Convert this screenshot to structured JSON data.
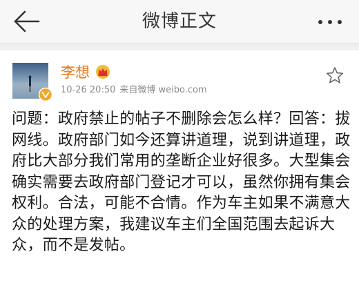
{
  "header": {
    "title": "微博正文",
    "back_icon": "back-arrow-icon",
    "more_icon": "more-dots-icon"
  },
  "post": {
    "author": "李想",
    "author_badge_icon": "crown-icon",
    "verified_icon": "verified-v-icon",
    "time": "10-26 20:50",
    "source": "来自微博 weibo.com",
    "favorite_icon": "star-outline-icon",
    "text": "问题：政府禁止的帖子不删除会怎么样？回答：拔网线。政府部门如今还算讲道理，说到讲道理，政府比大部分我们常用的垄断企业好很多。大型集会确实需要去政府部门登记才可以，虽然你拥有集会权利。合法，可能不合情。作为车主如果不满意大众的处理方案，我建议车主们全国范围去起诉大众，而不是发帖。"
  },
  "colors": {
    "username": "#e8710a",
    "meta": "#8a8a8a",
    "verified_badge": "#f5a623"
  }
}
